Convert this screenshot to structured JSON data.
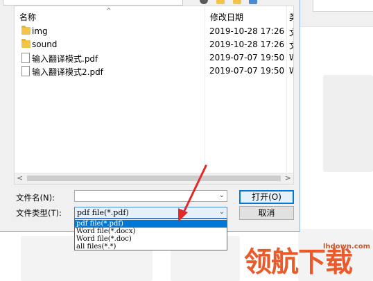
{
  "background": {
    "accent": "#d0d0d0"
  },
  "dialog": {
    "list": {
      "headers": {
        "name": "名称",
        "date_modified": "修改日期",
        "type": "类"
      },
      "rows": [
        {
          "kind": "folder",
          "name": "img",
          "date": "2019-10-28 17:26",
          "type": "文"
        },
        {
          "kind": "folder",
          "name": "sound",
          "date": "2019-10-28 17:26",
          "type": "文"
        },
        {
          "kind": "file",
          "name": "输入翻译模式.pdf",
          "date": "2019-07-07 19:50",
          "type": "W"
        },
        {
          "kind": "file",
          "name": "输入翻译模式2.pdf",
          "date": "2019-07-07 19:50",
          "type": "W"
        }
      ]
    },
    "filename_label": "文件名(N):",
    "filename_value": "",
    "filetype_label": "文件类型(T):",
    "filetype_selected": "pdf file(*.pdf)",
    "open_button": "打开(O)",
    "cancel_button": "取消",
    "filetype_options": [
      "pdf file(*.pdf)",
      "Word file(*.docx)",
      "Word file(*.doc)",
      "all files(*.*)"
    ]
  },
  "watermark": {
    "brand": "领航下载",
    "url": "lhdown.com",
    "color": "#ea5a2a"
  },
  "colors": {
    "selection": "#0078d7",
    "folder": "#f2c54a",
    "arrow": "#e02a2a"
  }
}
